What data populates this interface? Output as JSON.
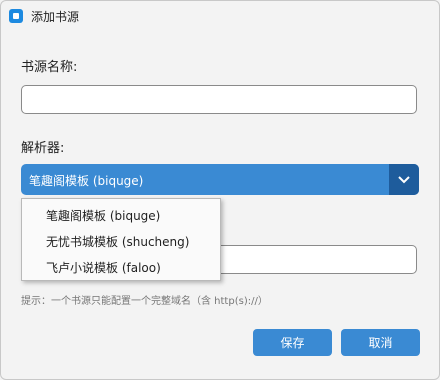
{
  "window": {
    "title": "添加书源"
  },
  "form": {
    "name_label": "书源名称:",
    "name_value": "",
    "parser_label": "解析器:",
    "parser_selected": "笔趣阁模板 (biquge)",
    "parser_options": [
      "笔趣阁模板 (biquge)",
      "无忧书城模板 (shucheng)",
      "飞卢小说模板 (faloo)"
    ],
    "domain_value": "",
    "hint": "提示：一个书源只能配置一个完整域名（含 http(s)://）"
  },
  "buttons": {
    "save": "保存",
    "cancel": "取消"
  },
  "colors": {
    "accent": "#3a8ad3",
    "accent_dark": "#1e5c9c"
  }
}
